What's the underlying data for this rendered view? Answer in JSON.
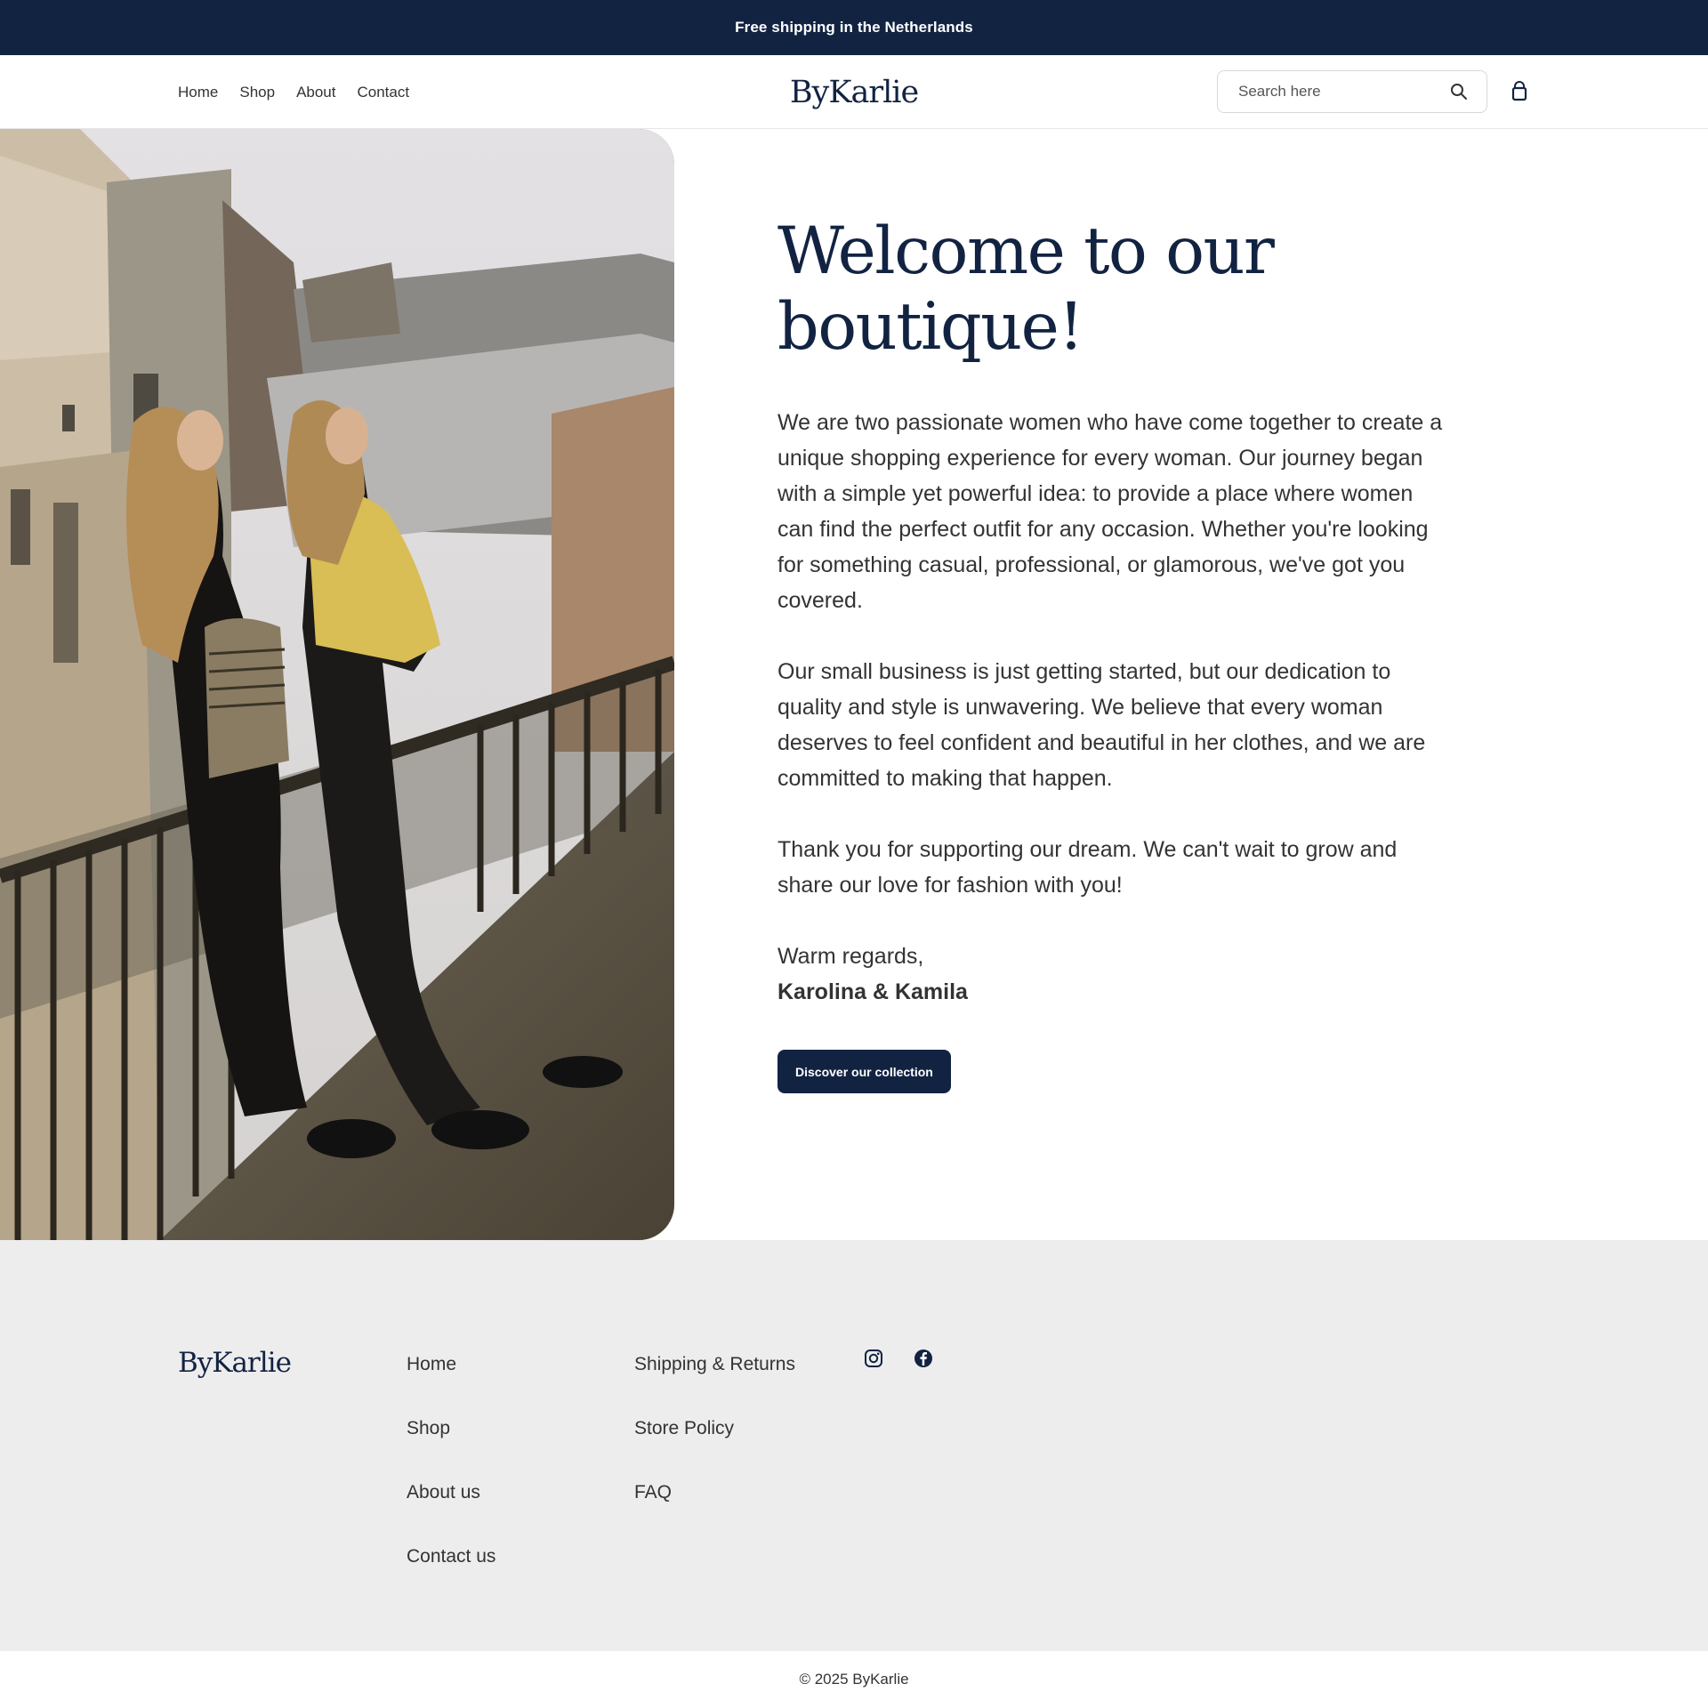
{
  "announcement": {
    "text": "Free shipping in the Netherlands"
  },
  "header": {
    "nav": [
      "Home",
      "Shop",
      "About",
      "Contact"
    ],
    "logo": "ByKarlie",
    "search": {
      "placeholder": "Search here",
      "value": "",
      "icon": "search-icon"
    },
    "cart_icon": "shopping-bag-icon"
  },
  "hero": {
    "image_alt": "Two women leaning on a balcony railing",
    "title": "Welcome to our boutique!",
    "paragraphs": [
      "We are two passionate women who have come together to create a unique shopping experience for every woman. Our journey began with a simple yet powerful idea: to provide a place where women can find the perfect outfit for any occasion. Whether you're looking for something casual, professional, or glamorous, we've got you covered.",
      "Our small business is just getting started, but our dedication to quality and style is unwavering. We believe that every woman deserves to feel confident and beautiful in her clothes, and we are committed to making that happen.",
      "Thank you for supporting our dream. We can't wait to grow and share our love for fashion with you!"
    ],
    "signoff": "Warm regards,",
    "signature": "Karolina & Kamila",
    "cta": "Discover our collection"
  },
  "footer": {
    "logo": "ByKarlie",
    "col1": [
      "Home",
      "Shop",
      "About us",
      "Contact us"
    ],
    "col2": [
      "Shipping & Returns",
      "Store Policy",
      "FAQ"
    ],
    "social": [
      "instagram-icon",
      "facebook-icon"
    ],
    "copyright": "© 2025 ByKarlie"
  },
  "colors": {
    "navy": "#122342",
    "footer_bg": "#ededed",
    "text": "#333333"
  }
}
